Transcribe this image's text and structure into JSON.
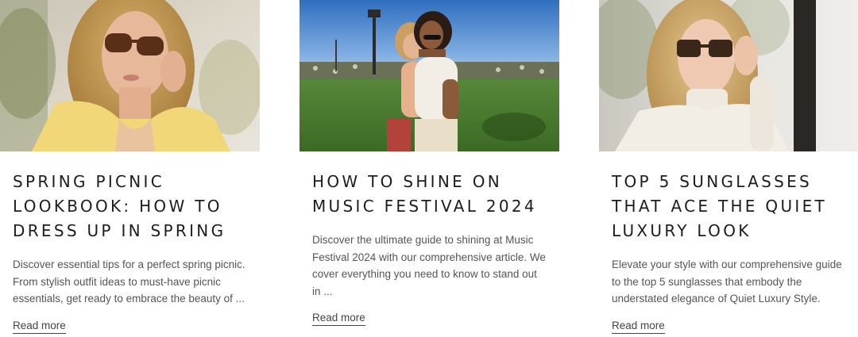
{
  "articles": [
    {
      "title": "Spring Picnic Lookbook: How to Dress Up in Spring",
      "excerpt": "Discover essential tips for a perfect spring picnic. From stylish outfit ideas to must-have picnic essentials, get ready to embrace the beauty of ...",
      "read_more": "Read more",
      "image": "woman-with-sunglasses-yellow-cardigan-photo"
    },
    {
      "title": "How to Shine on Music Festival 2024",
      "excerpt": "Discover the ultimate guide to shining at Music Festival 2024 with our comprehensive article. We cover everything you need to know to stand out in ...",
      "read_more": "Read more",
      "image": "friends-at-music-festival-photo"
    },
    {
      "title": "Top 5 Sunglasses That Ace the Quiet Luxury Look",
      "excerpt": "Elevate your style with our comprehensive guide to the top 5 sunglasses that embody the understated elegance of Quiet Luxury Style.",
      "read_more": "Read more",
      "image": "woman-in-turtleneck-sunglasses-photo"
    }
  ]
}
